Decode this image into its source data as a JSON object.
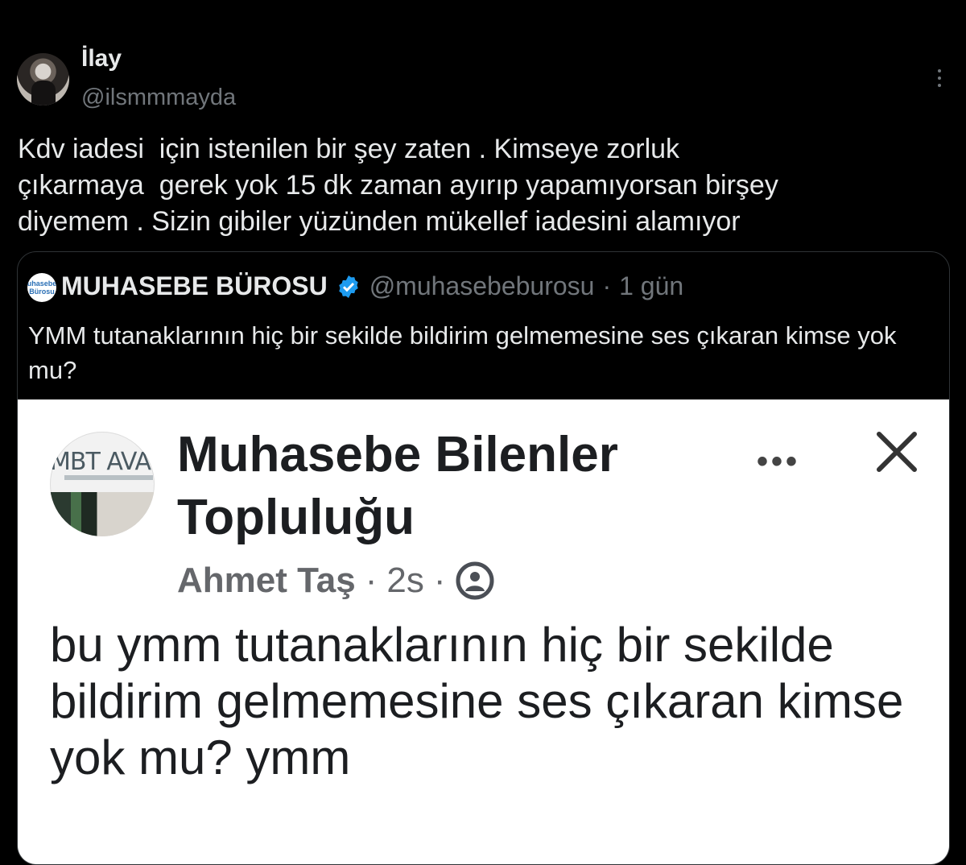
{
  "tweet": {
    "display_name": "İlay",
    "handle": "@ilsmmmayda",
    "text": "Kdv iadesi  için istenilen bir şey zaten . Kimseye zorluk\nçıkarmaya  gerek yok 15 dk zaman ayırıp yapamıyorsan birşey\ndiyemem . Sizin gibiler yüzünden mükellef iadesini alamıyor"
  },
  "quote": {
    "avatar_text": "uhasebe\nBürosu",
    "name": "MUHASEBE BÜROSU",
    "handle": "@muhasebeburosu",
    "separator": "·",
    "time": "1 gün",
    "text": "YMM tutanaklarının hiç bir sekilde bildirim gelmemesine ses çıkaran kimse yok mu?",
    "verified_color": "#1d9bf0"
  },
  "screenshot": {
    "logo_text": "MBT AVANTA",
    "group_name": "Muhasebe Bilenler Topluluğu",
    "more_icon": "•••",
    "author": "Ahmet Taş",
    "separator": "·",
    "time": "2s",
    "post_text": "bu ymm tutanaklarının hiç bir sekilde bildirim gelmemesine ses çıkaran kimse yok mu? ymm"
  },
  "icons": [
    "more-vertical-icon",
    "verified-badge-icon",
    "close-icon",
    "audience-icon"
  ]
}
